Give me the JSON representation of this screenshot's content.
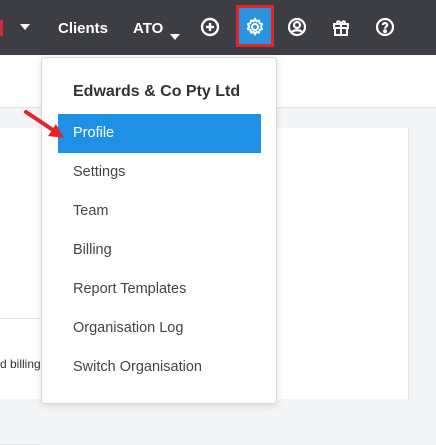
{
  "topbar": {
    "nav": {
      "clients": "Clients",
      "ato": "ATO"
    },
    "icons": [
      "chevron-down-icon",
      "plus-circle-icon",
      "gear-icon",
      "user-circle-icon",
      "gift-icon",
      "help-circle-icon"
    ],
    "active_color": "#2b94e1",
    "highlight_color": "#e2242b"
  },
  "background": {
    "billing_fragment": "d billing"
  },
  "dropdown": {
    "org_name": "Edwards & Co Pty Ltd",
    "items": [
      {
        "label": "Profile",
        "active": true
      },
      {
        "label": "Settings"
      },
      {
        "label": "Team"
      },
      {
        "label": "Billing"
      },
      {
        "label": "Report Templates"
      },
      {
        "label": "Organisation Log"
      },
      {
        "label": "Switch Organisation"
      }
    ]
  }
}
